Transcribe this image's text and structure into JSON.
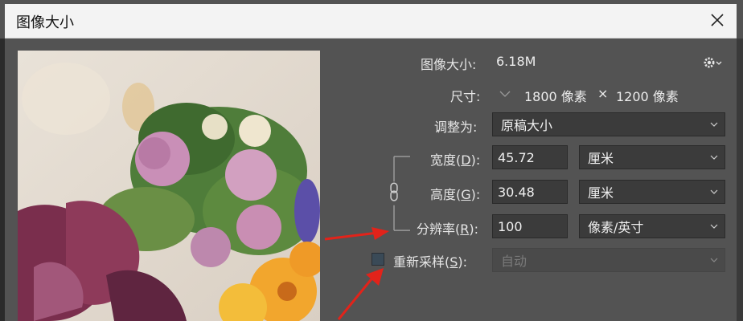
{
  "window": {
    "title": "图像大小"
  },
  "info": {
    "image_size_label": "图像大小:",
    "image_size_value": "6.18M",
    "dimensions_label": "尺寸:",
    "width_px": "1800 像素",
    "times": "×",
    "height_px": "1200 像素"
  },
  "fit": {
    "label": "调整为:",
    "value": "原稿大小"
  },
  "width": {
    "label_pre": "宽度(",
    "key": "D",
    "label_post": "):",
    "value": "45.72",
    "unit": "厘米"
  },
  "height": {
    "label_pre": "高度(",
    "key": "G",
    "label_post": "):",
    "value": "30.48",
    "unit": "厘米"
  },
  "resolution": {
    "label_pre": "分辨率(",
    "key": "R",
    "label_post": "):",
    "value": "100",
    "unit": "像素/英寸"
  },
  "resample": {
    "label_pre": "重新采样(",
    "key": "S",
    "label_post": "):",
    "value": "自动",
    "checked": false
  },
  "colors": {
    "dialog_bg": "#535353",
    "field_bg": "#3b3b3b",
    "arrow": "#e2231a"
  },
  "icons": [
    "close-icon",
    "gear-icon",
    "chevron-down-icon",
    "chain-link-icon",
    "arrow-annotation"
  ]
}
